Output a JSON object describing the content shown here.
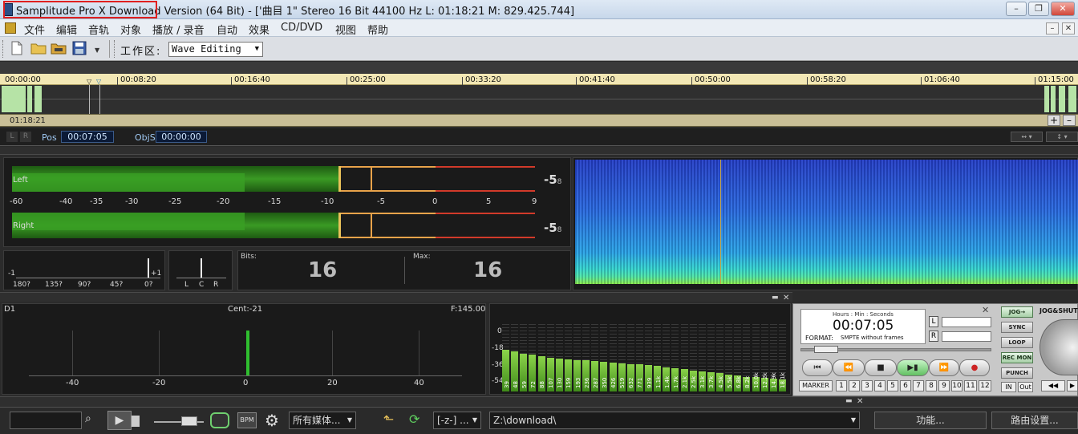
{
  "window": {
    "title": "Samplitude Pro X Download Version (64 Bit) - ['曲目 1\"  Stereo 16 Bit 44100 Hz L: 01:18:21  M: 829.425.744]",
    "minimize": "–",
    "restore": "❐",
    "close": "✕"
  },
  "menu": {
    "items": [
      "文件",
      "编辑",
      "音轨",
      "对象",
      "播放 / 录音",
      "自动",
      "效果",
      "CD/DVD",
      "视图",
      "帮助"
    ],
    "mdi_minimize": "–",
    "mdi_close": "✕"
  },
  "toolbar": {
    "workspace_label": "工作区:",
    "workspace_value": "Wave Editing"
  },
  "timeline": {
    "ruler_labels": [
      "00:00:00",
      "00:08:20",
      "00:16:40",
      "00:25:00",
      "00:33:20",
      "00:41:40",
      "00:50:00",
      "00:58:20",
      "01:06:40",
      "01:15:00"
    ],
    "scroll_time": "01:18:21",
    "zoom_plus": "+",
    "zoom_minus": "–"
  },
  "position": {
    "pos_label": "Pos",
    "pos_value": "00:07:05",
    "objs_label": "ObjS",
    "objs_value": "00:00:00",
    "l_label": "L",
    "r_label": "R"
  },
  "level_meter": {
    "left_label": "Left",
    "right_label": "Right",
    "left_peak": "-5",
    "left_peak_dec": "8",
    "right_peak": "-5",
    "right_peak_dec": "8",
    "scale": [
      "-60",
      "-40",
      "-35",
      "-30",
      "-25",
      "-20",
      "-15",
      "-10",
      "-5",
      "0",
      "5",
      "9"
    ]
  },
  "phase": {
    "minus_one": "-1",
    "plus_one": "+1",
    "degrees": [
      "180?",
      "135?",
      "90?",
      "45?",
      "0?"
    ]
  },
  "correlation": {
    "labels": [
      "L",
      "C",
      "R"
    ]
  },
  "bits": {
    "bits_label": "Bits:",
    "bits_value": "16",
    "max_label": "Max:",
    "max_value": "16"
  },
  "tuner": {
    "note": "D1",
    "cent": "Cent:-21",
    "freq": "F:145.00",
    "scale": [
      "-40",
      "-20",
      "0",
      "20",
      "40"
    ]
  },
  "analyzer": {
    "y_labels": [
      "0",
      "-18",
      "-36",
      "-54"
    ],
    "freq_labels": [
      "39",
      "48",
      "59",
      "72",
      "88",
      "107",
      "130",
      "159",
      "193",
      "236",
      "287",
      "350",
      "426",
      "519",
      "632",
      "771",
      "939",
      "1.1k",
      "1.4k",
      "1.7k",
      "2.1k",
      "2.5k",
      "3.1k",
      "3.7k",
      "4.5k",
      "5.5k",
      "6.8k",
      "8.2k",
      "10.0k",
      "12.2k",
      "14.9k",
      "18.1k"
    ],
    "levels": [
      0.62,
      0.6,
      0.56,
      0.55,
      0.52,
      0.5,
      0.49,
      0.48,
      0.47,
      0.46,
      0.45,
      0.44,
      0.43,
      0.42,
      0.41,
      0.4,
      0.39,
      0.38,
      0.36,
      0.35,
      0.33,
      0.31,
      0.3,
      0.28,
      0.27,
      0.25,
      0.24,
      0.22,
      0.21,
      0.2,
      0.19,
      0.18
    ]
  },
  "transport": {
    "time_caption": "Hours : Min : Seconds",
    "time_value": "00:07:05",
    "format_label": "FORMAT:",
    "format_value": "SMPTE without frames",
    "l_label": "L",
    "r_label": "R",
    "jog_label": "JOG→",
    "sync_label": "SYNC",
    "loop_label": "LOOP",
    "recmon_label": "REC MON",
    "punch_label": "PUNCH",
    "in_label": "IN",
    "out_label": "Out",
    "marker_label": "MARKER",
    "numbers": [
      "1",
      "2",
      "3",
      "4",
      "5",
      "6",
      "7",
      "8",
      "9",
      "10",
      "11",
      "12"
    ],
    "jog_shuttle": "JOG&SHUTTLE",
    "close": "✕"
  },
  "bottom": {
    "media_filter": "所有媒体...",
    "filter_z": "[-z-] ...",
    "path": "Z:\\download\\",
    "bpm": "BPM",
    "function_btn": "功能...",
    "routing_btn": "路由设置..."
  },
  "colors": {
    "meter_green": "#2f8a1c",
    "meter_orange": "#e8a34a",
    "meter_red": "#d23a2a",
    "accent_blue": "#3b5b8a"
  }
}
